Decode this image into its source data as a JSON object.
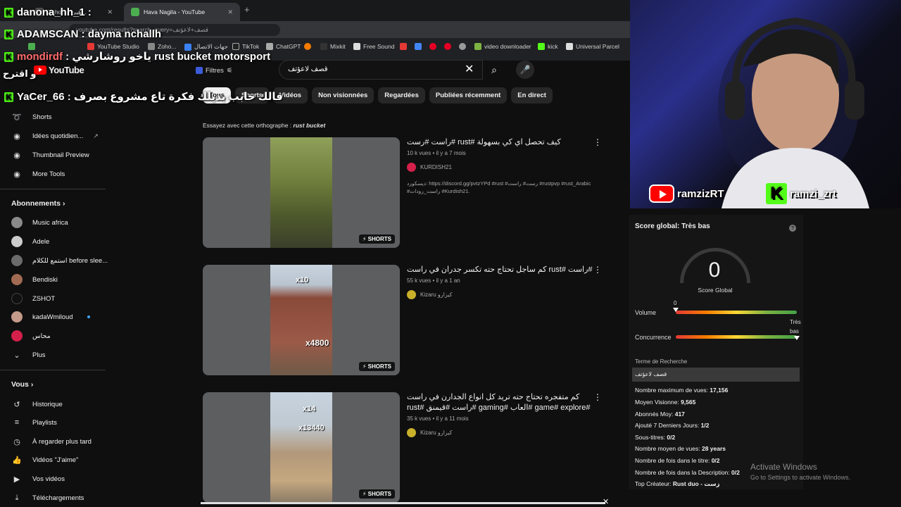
{
  "browser": {
    "tab1_title": "Zoho... | هيئ...",
    "tab2_title": "Hava Nagila - YouTube",
    "new_tab": "+",
    "url": "youtube.com/results?search_query=قصف+لاعؤتف",
    "bookmarks": [
      "YouTube Studio",
      "Zoho...",
      "جهات الاتصال",
      "TikTok",
      "ChatGPT",
      "Mixkit",
      "Free Sound",
      "video downloader",
      "kick",
      "Universal Parcel"
    ]
  },
  "header": {
    "logo": "YouTube",
    "filters_label": "Filtres",
    "search_value": "قصف لاعؤتف",
    "clear_icon": "✕",
    "search_icon": "⌕",
    "mic_icon": "🎤"
  },
  "chips": [
    "Tous",
    "Shorts",
    "Vidéos",
    "Non visionnées",
    "Regardées",
    "Publiées récemment",
    "En direct"
  ],
  "sidebar": {
    "top_items": [
      {
        "label": "Shorts",
        "icon": "shorts-icon"
      },
      {
        "label": "Idées quotidien...",
        "icon": "ideas-icon"
      },
      {
        "label": "Thumbnail Preview",
        "icon": "thumbnail-icon"
      },
      {
        "label": "More Tools",
        "icon": "tools-icon"
      }
    ],
    "subs_header": "Abonnements",
    "subs": [
      {
        "label": "Music africa",
        "color": "#8a8a8a"
      },
      {
        "label": "Adele",
        "color": "#ccc"
      },
      {
        "label": "استمع للكلام before slee...",
        "color": "#6b6b6b"
      },
      {
        "label": "Bendiski",
        "color": "#a06b52"
      },
      {
        "label": "ZSHOT",
        "color": "#111"
      },
      {
        "label": "kadaWmiloud",
        "color": "#c49a8a"
      },
      {
        "label": "محاس",
        "color": "#d4204a"
      }
    ],
    "plus": "Plus",
    "vous_header": "Vous",
    "vous_items": [
      {
        "label": "Historique",
        "icon": "history-icon"
      },
      {
        "label": "Playlists",
        "icon": "playlist-icon"
      },
      {
        "label": "À regarder plus tard",
        "icon": "clock-icon"
      },
      {
        "label": "Vidéos \"J'aime\"",
        "icon": "like-icon"
      },
      {
        "label": "Vos vidéos",
        "icon": "video-icon"
      },
      {
        "label": "Téléchargements",
        "icon": "download-icon"
      }
    ]
  },
  "spell": {
    "prefix": "Essayez avec cette orthographe :",
    "suggestion": "rust bucket"
  },
  "videos": [
    {
      "title": "راست #رست# rust# كيف تحصل اي كي بسهولة",
      "meta": "10 k vues • il y a 7 mois",
      "channel": "KURDISH21",
      "desc": "ديسكورد: https://discord.gg/pvtzYPd #rust #رست# راست #rustpvp #rust_Arabic #راست_رودات #Kurdish21.",
      "badge": "SHORTS"
    },
    {
      "title": "كم ساجل تحتاج حته تكسر جدران في راست rust# راست#",
      "meta": "55 k vues • il y a 1 an",
      "channel": "Kizaru كيزارو",
      "desc": "",
      "badge": "SHORTS",
      "overlay_top": "x10",
      "overlay_bottom": "x4800"
    },
    {
      "title": "كم متفجره تحتاج حته تريد كل انواع الجدارن في راست rust# راست #قيمنق# gaming# العاب# game# explore#",
      "meta": "35 k vues • il y a 11 mois",
      "channel": "Kizaru كيزارو",
      "desc": "",
      "badge": "SHORTS",
      "overlay_top": "x14",
      "overlay_bottom": "x13440"
    }
  ],
  "chat": [
    {
      "user": "danona_hh_1",
      "msg": ""
    },
    {
      "user": "ADAMSCAN",
      "msg": "dayma nchallh"
    },
    {
      "user": "mondirdf",
      "msg": "ياخو روشارشي rust bucket motorsport"
    },
    {
      "user": "",
      "msg": "و اقترح"
    },
    {
      "user": "YaCer_66",
      "msg": "فالك حابب بديلك فكرة تاع مشروع بصرف"
    }
  ],
  "socials": {
    "youtube": "ramzizRT",
    "kick": "ramzi_zrt"
  },
  "seo": {
    "score_title": "Score global: Très bas",
    "help": "?",
    "score_value": "0",
    "score_label": "Score Global",
    "volume_label": "Volume",
    "volume_value": "0",
    "volume_level": 0.0,
    "tres_bas": "Très bas",
    "concurrence_label": "Concurrence",
    "concurrence_level": 1.0,
    "terme_label": "Terme de Recherche",
    "terme_value": "قصف لاعؤتف",
    "stats": [
      {
        "label": "Nombre maximum de vues:",
        "value": "17,156"
      },
      {
        "label": "Moyen Visionne:",
        "value": "9,565"
      },
      {
        "label": "Abonnés Moy:",
        "value": "417"
      },
      {
        "label": "Ajouté 7 Derniers Jours:",
        "value": "1/2"
      },
      {
        "label": "Sous-titres:",
        "value": "0/2"
      },
      {
        "label": "Nombre moyen de vues:",
        "value": "28 years"
      },
      {
        "label": "Nombre de fois dans le titre:",
        "value": "0/2"
      },
      {
        "label": "Nombre de fois dans la Description:",
        "value": "0/2"
      },
      {
        "label": "Top Créateur:",
        "value": "Rust duo - زست"
      }
    ]
  },
  "windows": {
    "activate": "Activate Windows",
    "activate_sub": "Go to Settings to activate Windows."
  },
  "colors": {
    "kick_green": "#53fc18",
    "yt_red": "#ff0000"
  }
}
